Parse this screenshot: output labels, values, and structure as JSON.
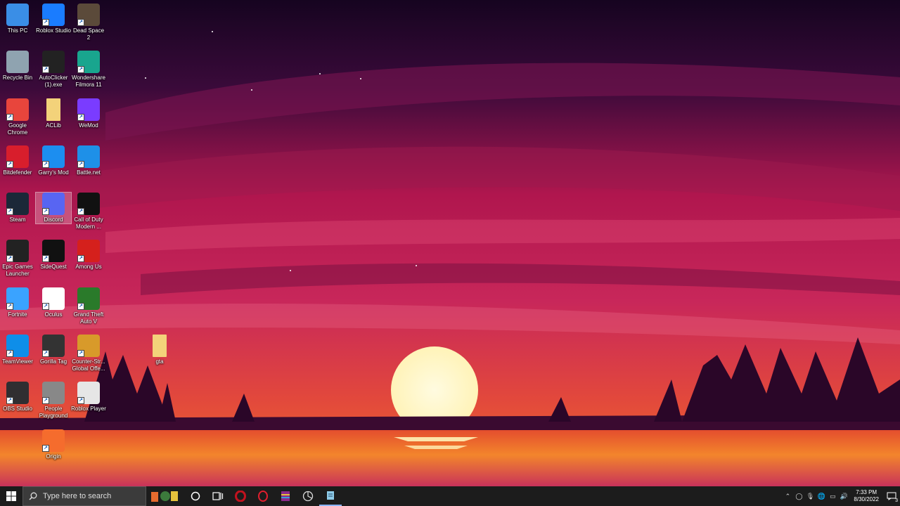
{
  "desktop": {
    "icons": [
      {
        "label": "This PC",
        "icon": "this-pc-icon",
        "color": "#3a8ee6"
      },
      {
        "label": "Roblox Studio",
        "icon": "roblox-studio-icon",
        "color": "#1a7cff"
      },
      {
        "label": "Dead Space 2",
        "icon": "dead-space-icon",
        "color": "#5b4a3a"
      },
      {
        "label": "Recycle Bin",
        "icon": "recycle-bin-icon",
        "color": "#8fa3b0"
      },
      {
        "label": "AutoClicker (1).exe",
        "icon": "autoclicker-icon",
        "color": "#222222"
      },
      {
        "label": "Wondershare Filmora 11",
        "icon": "filmora-icon",
        "color": "#19a58e"
      },
      {
        "label": "Google Chrome",
        "icon": "chrome-icon",
        "color": "#e8453c"
      },
      {
        "label": "ACLib",
        "icon": "folder-icon",
        "color": "#f3d27a"
      },
      {
        "label": "WeMod",
        "icon": "wemod-icon",
        "color": "#7a3cff"
      },
      {
        "label": "Bitdefender",
        "icon": "bitdefender-icon",
        "color": "#d81e2c"
      },
      {
        "label": "Garry's Mod",
        "icon": "garrys-mod-icon",
        "color": "#1c8ef0"
      },
      {
        "label": "Battle.net",
        "icon": "battlenet-icon",
        "color": "#1e90e8"
      },
      {
        "label": "Steam",
        "icon": "steam-icon",
        "color": "#1b2838"
      },
      {
        "label": "Discord",
        "icon": "discord-icon",
        "color": "#5865f2"
      },
      {
        "label": "Call of Duty Modern ...",
        "icon": "cod-mw-icon",
        "color": "#111111"
      },
      {
        "label": "Epic Games Launcher",
        "icon": "epic-games-icon",
        "color": "#222222"
      },
      {
        "label": "SideQuest",
        "icon": "sidequest-icon",
        "color": "#111111"
      },
      {
        "label": "Among Us",
        "icon": "among-us-icon",
        "color": "#d5201c"
      },
      {
        "label": "Fortnite",
        "icon": "fortnite-icon",
        "color": "#3aa3ff"
      },
      {
        "label": "Oculus",
        "icon": "oculus-icon",
        "color": "#ffffff"
      },
      {
        "label": "Grand Theft Auto V",
        "icon": "gta-v-icon",
        "color": "#2a7a2a"
      },
      {
        "label": "TeamViewer",
        "icon": "teamviewer-icon",
        "color": "#0e8ee9"
      },
      {
        "label": "Gorilla Tag",
        "icon": "gorilla-tag-icon",
        "color": "#333333"
      },
      {
        "label": "Counter-Str... Global Offe...",
        "icon": "csgo-icon",
        "color": "#d89a2a"
      },
      {
        "label": "OBS Studio",
        "icon": "obs-icon",
        "color": "#302e31"
      },
      {
        "label": "People Playground",
        "icon": "people-playground-icon",
        "color": "#888888"
      },
      {
        "label": "Roblox Player",
        "icon": "roblox-player-icon",
        "color": "#e6e6e6"
      },
      {
        "label": "Origin",
        "icon": "origin-icon",
        "color": "#f56c2d"
      },
      {
        "label": "gta",
        "icon": "folder-icon",
        "color": "#f3d27a"
      }
    ],
    "selected_icon": "Discord"
  },
  "taskbar": {
    "start_icon": "windows-start-icon",
    "search_placeholder": "Type here to search",
    "pinned": [
      "cortana-circle-icon",
      "task-view-icon",
      "opera-gx-icon",
      "opera-icon",
      "winrar-icon",
      "chrome-like-icon",
      "notepad-icon"
    ],
    "clock_time": "7:33 PM",
    "clock_date": "8/30/2022",
    "notification_count": "3"
  },
  "colors": {
    "sky_top": "#1a0622",
    "sky_mid": "#c21e5a",
    "horizon": "#f05a3a",
    "sun": "#fff6c8",
    "water": "#f07a2a",
    "taskbar": "#1c1c1c"
  }
}
